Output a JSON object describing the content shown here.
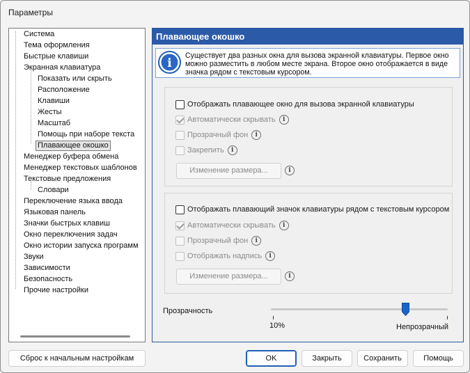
{
  "window": {
    "title": "Параметры"
  },
  "tree": {
    "items": [
      {
        "label": "Система",
        "level": 0
      },
      {
        "label": "Тема оформления",
        "level": 0
      },
      {
        "label": "Быстрые клавиши",
        "level": 0
      },
      {
        "label": "Экранная клавиатура",
        "level": 0
      },
      {
        "label": "Показать или скрыть",
        "level": 1
      },
      {
        "label": "Расположение",
        "level": 1
      },
      {
        "label": "Клавиши",
        "level": 1
      },
      {
        "label": "Жесты",
        "level": 1
      },
      {
        "label": "Масштаб",
        "level": 1
      },
      {
        "label": "Помощь при наборе текста",
        "level": 1
      },
      {
        "label": "Плавающее окошко",
        "level": 1,
        "selected": true
      },
      {
        "label": "Менеджер буфера обмена",
        "level": 0
      },
      {
        "label": "Менеджер текстовых шаблонов",
        "level": 0
      },
      {
        "label": "Текстовые предложения",
        "level": 0
      },
      {
        "label": "Словари",
        "level": 1
      },
      {
        "label": "Переключение языка ввода",
        "level": 0
      },
      {
        "label": "Языковая панель",
        "level": 0
      },
      {
        "label": "Значки быстрых клавиш",
        "level": 0
      },
      {
        "label": "Окно переключения задач",
        "level": 0
      },
      {
        "label": "Окно истории запуска программ",
        "level": 0
      },
      {
        "label": "Звуки",
        "level": 0
      },
      {
        "label": "Зависимости",
        "level": 0
      },
      {
        "label": "Безопасность",
        "level": 0
      },
      {
        "label": "Прочие настройки",
        "level": 0
      }
    ]
  },
  "panel": {
    "title": "Плавающее окошко",
    "info": "Существует два разных окна для вызова экранной клавиатуры. Первое окно можно разместить в любом месте экрана. Второе окно отображается в виде значка рядом с текстовым курсором.",
    "group1": {
      "main_checkbox": "Отображать плавающее окно для вызова экранной клавиатуры",
      "auto_hide": "Автоматически скрывать",
      "transparent_bg": "Прозрачный фон",
      "pin": "Закрепить",
      "resize_button": "Изменение размера..."
    },
    "group2": {
      "main_checkbox": "Отображать плавающий значок клавиатуры рядом с текстовым курсором",
      "auto_hide": "Автоматически скрывать",
      "transparent_bg": "Прозрачный фон",
      "show_caption": "Отображать надпись",
      "resize_button": "Изменение размера..."
    },
    "transparency": {
      "label": "Прозрачность",
      "min_label": "10%",
      "max_label": "Непрозрачный",
      "value_fraction": 0.76
    },
    "info_glyph": "i"
  },
  "footer": {
    "reset": "Сброс к начальным настройкам",
    "ok": "OK",
    "close": "Закрыть",
    "save": "Сохранить",
    "help": "Помощь"
  },
  "colors": {
    "accent": "#2b5aa8",
    "info_border": "#7aa3d8",
    "thumb": "#1b63c6"
  },
  "icons": {
    "info_large": "info-circle-icon",
    "help_small": "info-icon"
  }
}
